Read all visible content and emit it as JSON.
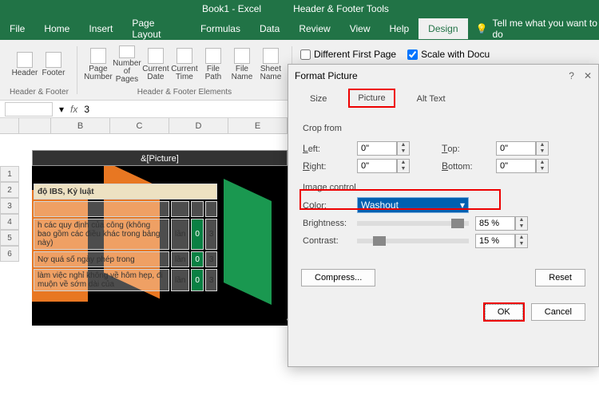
{
  "titlebar": {
    "doc": "Book1 - Excel",
    "tool_context": "Header & Footer Tools"
  },
  "menu": {
    "tabs": [
      "File",
      "Home",
      "Insert",
      "Page Layout",
      "Formulas",
      "Data",
      "Review",
      "View",
      "Help"
    ],
    "context_tab": "Design",
    "tell_me": "Tell me what you want to do"
  },
  "ribbon": {
    "groups": [
      {
        "name": "Header & Footer",
        "items": [
          {
            "label": "Header"
          },
          {
            "label": "Footer"
          }
        ]
      },
      {
        "name": "Header & Footer Elements",
        "items": [
          {
            "label": "Page Number"
          },
          {
            "label": "Number of Pages"
          },
          {
            "label": "Current Date"
          },
          {
            "label": "Current Time"
          },
          {
            "label": "File Path"
          },
          {
            "label": "File Name"
          },
          {
            "label": "Sheet Name"
          }
        ]
      }
    ],
    "options": {
      "diff_first": "Different First Page",
      "scale": "Scale with Docu"
    }
  },
  "formulabar": {
    "cell": "",
    "fx": "fx",
    "value": "3"
  },
  "columns": [
    "B",
    "C",
    "D",
    "E"
  ],
  "rows": [
    "1",
    "2",
    "3",
    "4",
    "5",
    "6"
  ],
  "sheet": {
    "header_field": "&[Picture]",
    "title": "độ IBS, Kỷ luật",
    "cells": [
      [
        "h các quy định của công (không bao gồm các điều khác trong bảng này)",
        "lần",
        "0",
        "3"
      ],
      [
        "Nợ quá số ngày phép trong",
        "lần",
        "0",
        "3"
      ],
      [
        "làm việc nghỉ không về hôm hẹp, đi muộn về sớm dài của",
        "lần",
        "0",
        "3"
      ]
    ]
  },
  "watermark_text": "shop",
  "dialog": {
    "title": "Format Picture",
    "tabs": [
      "Size",
      "Picture",
      "Alt Text"
    ],
    "active_tab": "Picture",
    "crop_section": "Crop from",
    "crop": {
      "left_label": "Left:",
      "left_val": "0\"",
      "right_label": "Right:",
      "right_val": "0\"",
      "top_label": "Top:",
      "top_val": "0\"",
      "bottom_label": "Bottom:",
      "bottom_val": "0\""
    },
    "image_section": "Image control",
    "color_label": "Color:",
    "color_val": "Washout",
    "brightness_label": "Brightness:",
    "brightness_val": "85 %",
    "contrast_label": "Contrast:",
    "contrast_val": "15 %",
    "compress": "Compress...",
    "reset": "Reset",
    "ok": "OK",
    "cancel": "Cancel"
  }
}
